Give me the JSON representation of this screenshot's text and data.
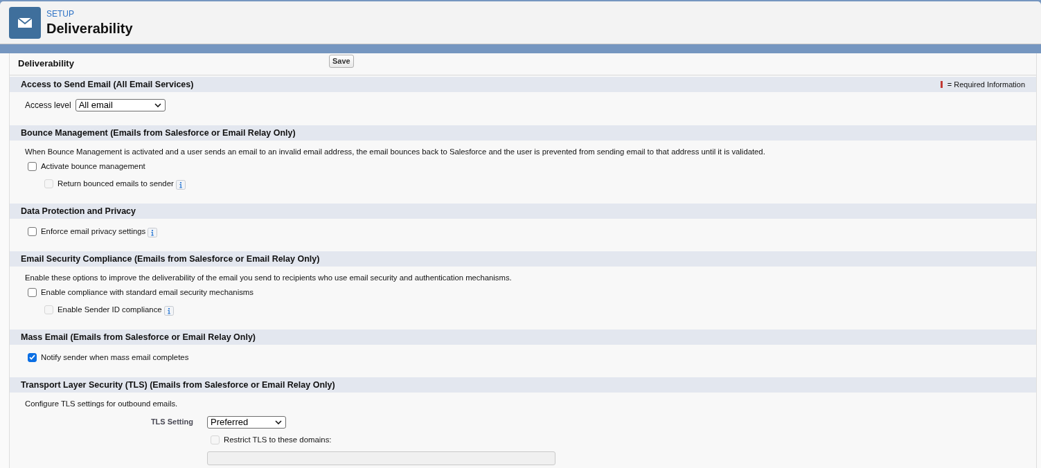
{
  "header": {
    "breadcrumb": "SETUP",
    "title": "Deliverability"
  },
  "panel": {
    "title": "Deliverability",
    "save_button": "Save"
  },
  "sections": [
    {
      "title": "Access to Send Email (All Email Services)",
      "legend": "= Required Information",
      "content": [
        {
          "kind": "select",
          "label": "Access level",
          "value": "All email"
        }
      ]
    },
    {
      "title": "Bounce Management (Emails from Salesforce or Email Relay Only)",
      "content": [
        {
          "kind": "text",
          "text": "When Bounce Management is activated and a user sends an email to an invalid email address, the email bounces back to Salesforce and the user is prevented from sending email to that address until it is validated."
        },
        {
          "kind": "checkbox",
          "label": "Activate bounce management",
          "checked": false,
          "disabled": false,
          "info": false,
          "children": [
            {
              "kind": "checkbox",
              "label": "Return bounced emails to sender",
              "checked": false,
              "disabled": true,
              "info": true
            }
          ]
        }
      ]
    },
    {
      "title": "Data Protection and Privacy",
      "content": [
        {
          "kind": "checkbox",
          "label": "Enforce email privacy settings",
          "checked": false,
          "disabled": false,
          "info": true
        }
      ]
    },
    {
      "title": "Email Security Compliance (Emails from Salesforce or Email Relay Only)",
      "content": [
        {
          "kind": "text",
          "text": "Enable these options to improve the deliverability of the email you send to recipients who use email security and authentication mechanisms."
        },
        {
          "kind": "checkbox",
          "label": "Enable compliance with standard email security mechanisms",
          "checked": false,
          "disabled": false,
          "info": false,
          "children": [
            {
              "kind": "checkbox",
              "label": "Enable Sender ID compliance",
              "checked": false,
              "disabled": true,
              "info": true
            }
          ]
        }
      ]
    },
    {
      "title": "Mass Email (Emails from Salesforce or Email Relay Only)",
      "content": [
        {
          "kind": "checkbox",
          "label": "Notify sender when mass email completes",
          "checked": true,
          "disabled": false,
          "info": false
        }
      ]
    },
    {
      "title": "Transport Layer Security (TLS) (Emails from Salesforce or Email Relay Only)",
      "content": [
        {
          "kind": "text",
          "text": "Configure TLS settings for outbound emails."
        },
        {
          "kind": "field_select",
          "label": "TLS Setting",
          "value": "Preferred"
        },
        {
          "kind": "field_checkbox",
          "label": "Restrict TLS to these domains:",
          "checked": false,
          "disabled": true
        },
        {
          "kind": "field_input",
          "disabled": true
        }
      ]
    }
  ]
}
